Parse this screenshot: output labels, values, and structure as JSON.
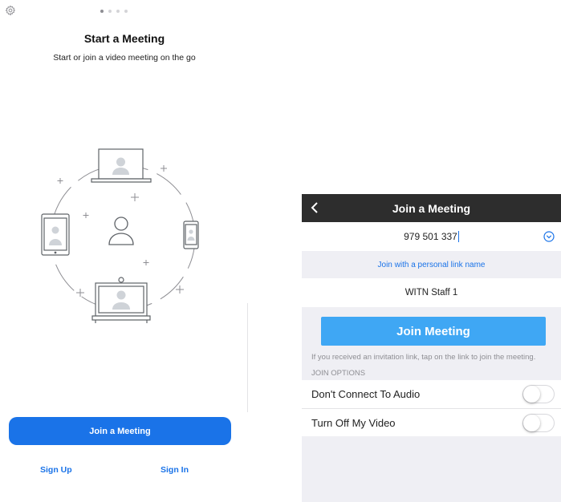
{
  "start": {
    "title": "Start a Meeting",
    "subtitle": "Start or join a video meeting on the go",
    "page_indicator": {
      "count": 4,
      "active": 1
    },
    "join_button": "Join a Meeting",
    "sign_up": "Sign Up",
    "sign_in": "Sign In"
  },
  "join": {
    "title": "Join a Meeting",
    "meeting_id": "979 501 337",
    "personal_link": "Join with a personal link name",
    "screen_name": "WITN Staff 1",
    "join_button": "Join Meeting",
    "hint": "If you received an invitation link, tap on the link to join the meeting.",
    "options_label": "JOIN OPTIONS",
    "options": [
      {
        "label": "Don't Connect To Audio",
        "on": false
      },
      {
        "label": "Turn Off My Video",
        "on": false
      }
    ]
  },
  "colors": {
    "accent": "#1a73e8",
    "join_button": "#3fa7f4",
    "nav_bar": "#2d2d2d",
    "grouped_background": "#efeff4"
  },
  "icons": [
    "gear-icon",
    "back-chevron-icon",
    "dropdown-chevron-icon",
    "laptop-icon",
    "tablet-icon",
    "phone-icon",
    "room-system-icon",
    "user-icon"
  ]
}
